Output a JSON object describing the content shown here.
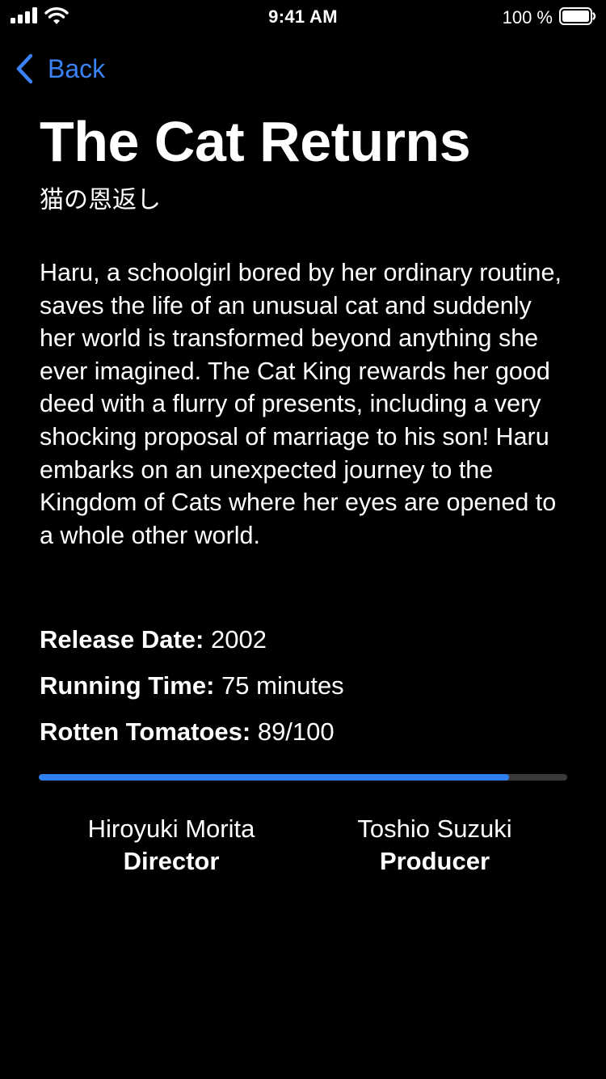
{
  "status_bar": {
    "time": "9:41 AM",
    "battery_percent": "100 %",
    "icons": [
      "signal-icon",
      "wifi-icon",
      "battery-icon"
    ]
  },
  "nav": {
    "back_label": "Back",
    "back_icon": "chevron-left-icon"
  },
  "film": {
    "title": "The Cat Returns",
    "original_title": "猫の恩返し",
    "description": "Haru, a schoolgirl bored by her ordinary routine, saves the life of an unusual cat and suddenly her world is transformed beyond anything she ever imagined. The Cat King rewards her good deed with a flurry of presents, including a very shocking proposal of marriage to his son! Haru embarks on an unexpected journey to the Kingdom of Cats where her eyes are opened to a whole other world.",
    "facts": {
      "release_label": "Release Date:",
      "release_value": "2002",
      "running_label": "Running Time:",
      "running_value": "75 minutes",
      "rt_label": "Rotten Tomatoes:",
      "rt_value": "89/100"
    },
    "rt_score": 89,
    "rt_max": 100,
    "director": {
      "name": "Hiroyuki Morita",
      "role": "Director"
    },
    "producer": {
      "name": "Toshio Suzuki",
      "role": "Producer"
    }
  },
  "colors": {
    "background": "#000000",
    "accent": "#3a82f7",
    "progress_fill": "#2f7ff0",
    "progress_track": "#3a3a3c",
    "text": "#ffffff"
  }
}
